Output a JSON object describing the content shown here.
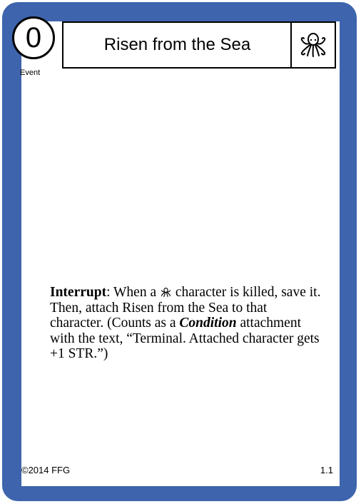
{
  "card": {
    "cost": "0",
    "title": "Risen from the Sea",
    "type": "Event",
    "house_icon": "kraken-icon",
    "rules": {
      "keyword": "Interrupt",
      "part1": ": When a ",
      "inline_icon": "kraken-icon",
      "part2": " character is killed, save it. Then, attach Risen from the Sea to that character. (Counts as a ",
      "condition": "Condition",
      "part3": " attachment with the text, “Terminal. Attached character gets +1 STR.”)"
    },
    "copyright": "©2014 FFG",
    "version": "1.1"
  },
  "colors": {
    "frame": "#3d64ad",
    "face": "#ffffff",
    "text": "#000000"
  }
}
